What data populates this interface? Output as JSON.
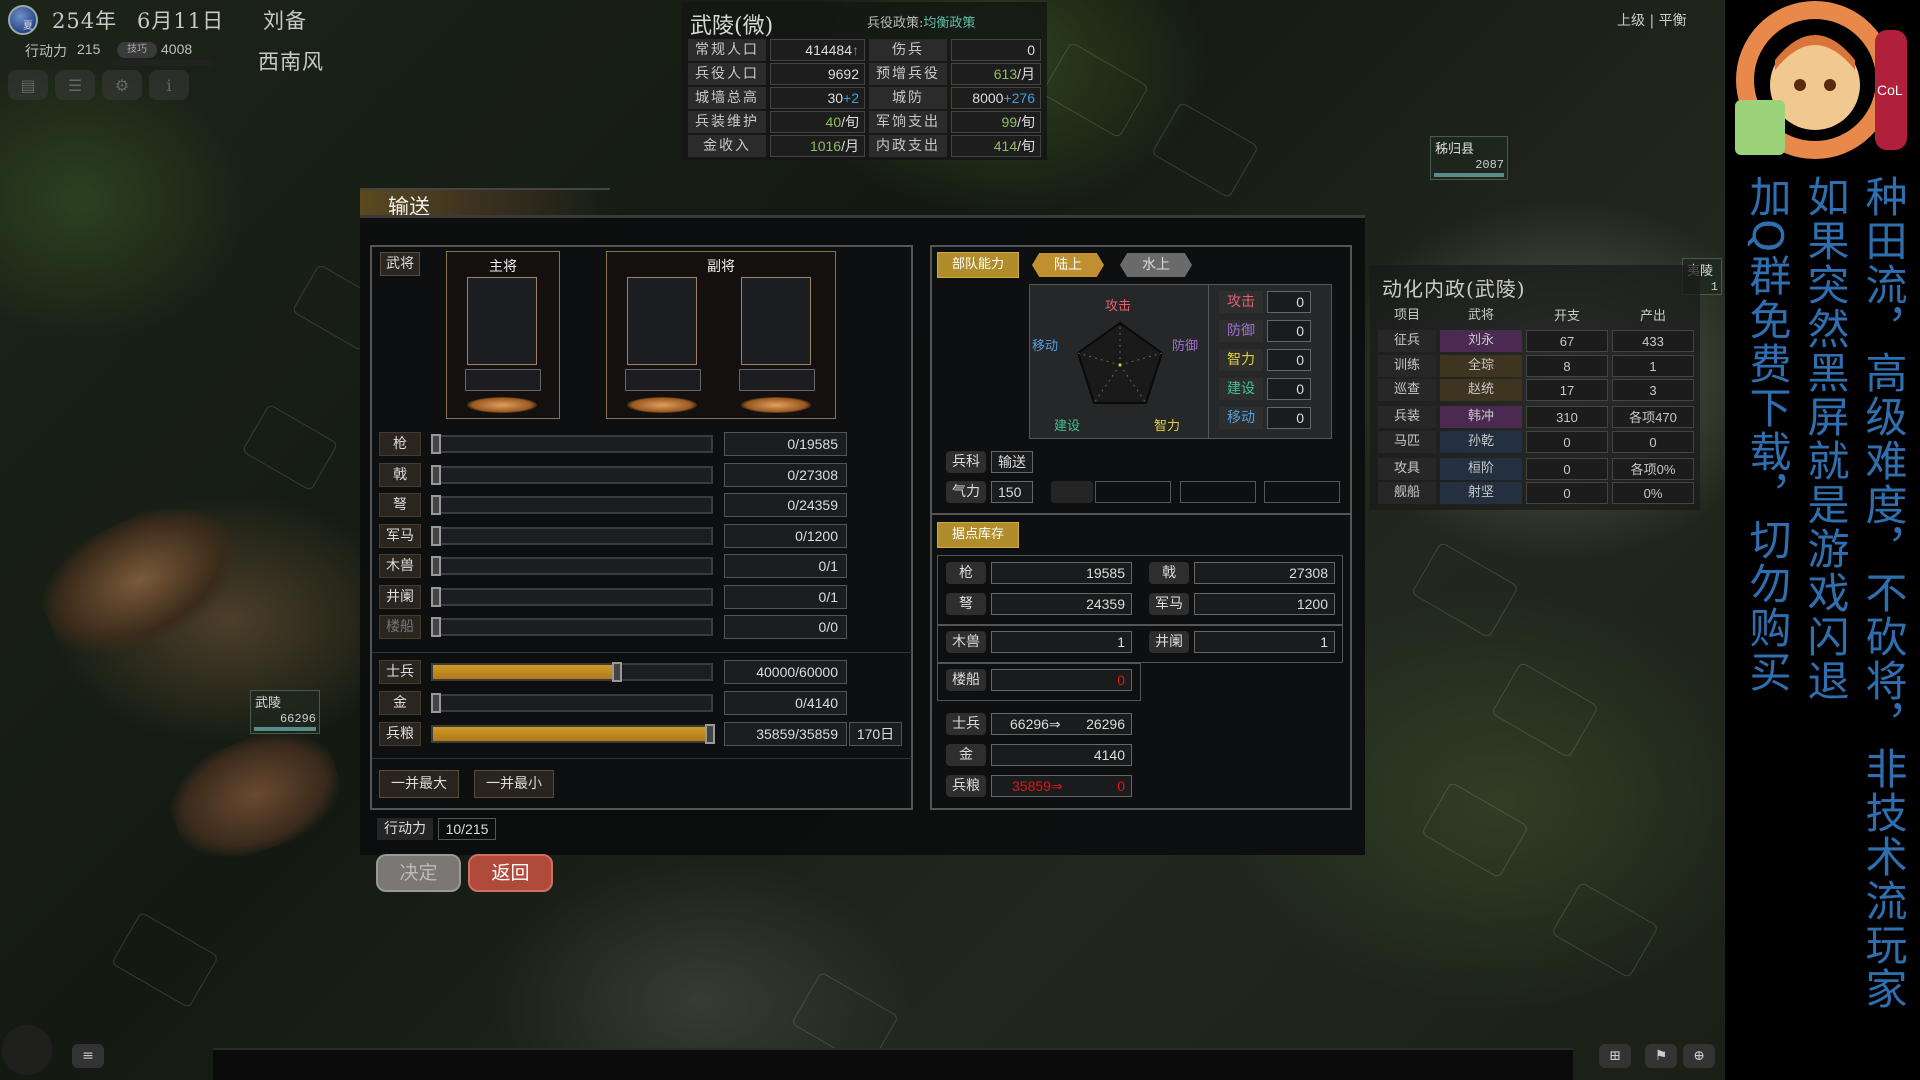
{
  "hud": {
    "season": "夏",
    "year": "254年",
    "date": "6月11日",
    "ruler": "刘备",
    "action_label": "行动力",
    "action_value": "215",
    "tech_label": "技巧",
    "tech_value": "4008",
    "wind": "西南风",
    "difficulty": "上级 | 平衡",
    "icons": [
      "calendar-icon",
      "list-icon",
      "gear-icon",
      "info-icon"
    ]
  },
  "city": {
    "title": "武陵(微)",
    "policy_label": "兵役政策:",
    "policy_value": "均衡政策",
    "rows": [
      {
        "l1": "常规人口",
        "v1": "414484",
        "v1_suffix": "↑",
        "l2": "伤兵",
        "v2": "0"
      },
      {
        "l1": "兵役人口",
        "v1": "9692",
        "l2": "预增兵役",
        "v2_green": "613",
        "v2_unit": "/月"
      },
      {
        "l1": "城墙总高",
        "v1": "30",
        "v1_plus": "+2",
        "l2": "城防",
        "v2": "8000",
        "v2_plus": "+276"
      },
      {
        "l1": "兵装维护",
        "v1_green": "40",
        "v1_unit": "/旬",
        "l2": "军饷支出",
        "v2_green": "99",
        "v2_unit": "/旬"
      },
      {
        "l1": "金收入",
        "v1_green": "1016",
        "v1_unit": "/月",
        "l2": "内政支出",
        "v2_green": "414",
        "v2_unit": "/旬"
      }
    ]
  },
  "dialog": {
    "title": "输送",
    "generals": {
      "tag": "武将",
      "main_label": "主将",
      "vice_label": "副将"
    },
    "sliders": [
      {
        "label": "枪",
        "value": "0/19585",
        "fraction": 0,
        "disabled": false
      },
      {
        "label": "戟",
        "value": "0/27308",
        "fraction": 0,
        "disabled": false
      },
      {
        "label": "弩",
        "value": "0/24359",
        "fraction": 0,
        "disabled": false
      },
      {
        "label": "军马",
        "value": "0/1200",
        "fraction": 0,
        "disabled": false
      },
      {
        "label": "木兽",
        "value": "0/1",
        "fraction": 0,
        "disabled": false
      },
      {
        "label": "井阑",
        "value": "0/1",
        "fraction": 0,
        "disabled": false
      },
      {
        "label": "楼船",
        "value": "0/0",
        "fraction": 0,
        "disabled": true
      }
    ],
    "resources": [
      {
        "label": "士兵",
        "value": "40000/60000",
        "fraction": 0.667
      },
      {
        "label": "金",
        "value": "0/4140",
        "fraction": 0
      },
      {
        "label": "兵粮",
        "value": "35859/35859",
        "fraction": 1.0,
        "days": "170日"
      }
    ],
    "max_all": "一并最大",
    "min_all": "一并最小",
    "action_label": "行动力",
    "action_value": "10/215",
    "confirm": "决定",
    "back": "返回"
  },
  "unit": {
    "section_tab": "部队能力",
    "tabs": [
      "陆上",
      "水上"
    ],
    "radar_labels": {
      "attack": "攻击",
      "defense": "防御",
      "intellect": "智力",
      "build": "建设",
      "move": "移动"
    },
    "stats": [
      {
        "label": "攻击",
        "value": "0",
        "color": "#e06070"
      },
      {
        "label": "防御",
        "value": "0",
        "color": "#a070d0"
      },
      {
        "label": "智力",
        "value": "0",
        "color": "#e0d040"
      },
      {
        "label": "建设",
        "value": "0",
        "color": "#40c090"
      },
      {
        "label": "移动",
        "value": "0",
        "color": "#50a0e0"
      }
    ],
    "type_label": "兵科",
    "type_value": "输送",
    "morale_label": "气力",
    "morale_value": "150"
  },
  "inventory": {
    "tab": "据点库存",
    "weapons": [
      {
        "label": "枪",
        "value": "19585"
      },
      {
        "label": "戟",
        "value": "27308"
      },
      {
        "label": "弩",
        "value": "24359"
      },
      {
        "label": "军马",
        "value": "1200"
      }
    ],
    "siege": [
      {
        "label": "木兽",
        "value": "1"
      },
      {
        "label": "井阑",
        "value": "1"
      }
    ],
    "ship": {
      "label": "楼船",
      "value": "0"
    },
    "soldiers": {
      "label": "士兵",
      "from": "66296⇒",
      "to": "26296"
    },
    "gold": {
      "label": "金",
      "value": "4140"
    },
    "food": {
      "label": "兵粮",
      "from": "35859⇒",
      "to": "0"
    }
  },
  "automation": {
    "title": "动化内政(武陵)",
    "headers": [
      "项目",
      "武将",
      "开支",
      "产出"
    ],
    "rows": [
      {
        "item": "征兵",
        "general": "刘永",
        "cost": "67",
        "output": "433",
        "tone": "purple"
      },
      {
        "item": "训练",
        "general": "全琮",
        "cost": "8",
        "output": "1",
        "tone": "amber"
      },
      {
        "item": "巡查",
        "general": "赵统",
        "cost": "17",
        "output": "3",
        "tone": "amber"
      },
      {
        "item": "兵装",
        "general": "韩冲",
        "cost": "310",
        "output": "各项470",
        "tone": "purple"
      },
      {
        "item": "马匹",
        "general": "孙乾",
        "cost": "0",
        "output": "0",
        "tone": "blue"
      },
      {
        "item": "攻具",
        "general": "桓阶",
        "cost": "0",
        "output": "各项0%",
        "tone": "blue"
      },
      {
        "item": "舰船",
        "general": "射坚",
        "cost": "0",
        "output": "0%",
        "tone": "blue"
      }
    ]
  },
  "map_labels": [
    {
      "name": "秭归县",
      "value": "2087"
    },
    {
      "name": "武陵",
      "value": "66296"
    },
    {
      "name": "夷陵",
      "value": "1"
    }
  ],
  "overlay": {
    "col1": "种田流，高级难度，不砍将，非技术流玩家",
    "col2": "如果突然黑屏就是游戏闪退",
    "col3": "加Q群免费下载，切勿购买",
    "color": "#2f6fb0"
  },
  "bottom_icons": [
    "menu-icon",
    "grid-icon",
    "flag-icon",
    "globe-icon"
  ]
}
